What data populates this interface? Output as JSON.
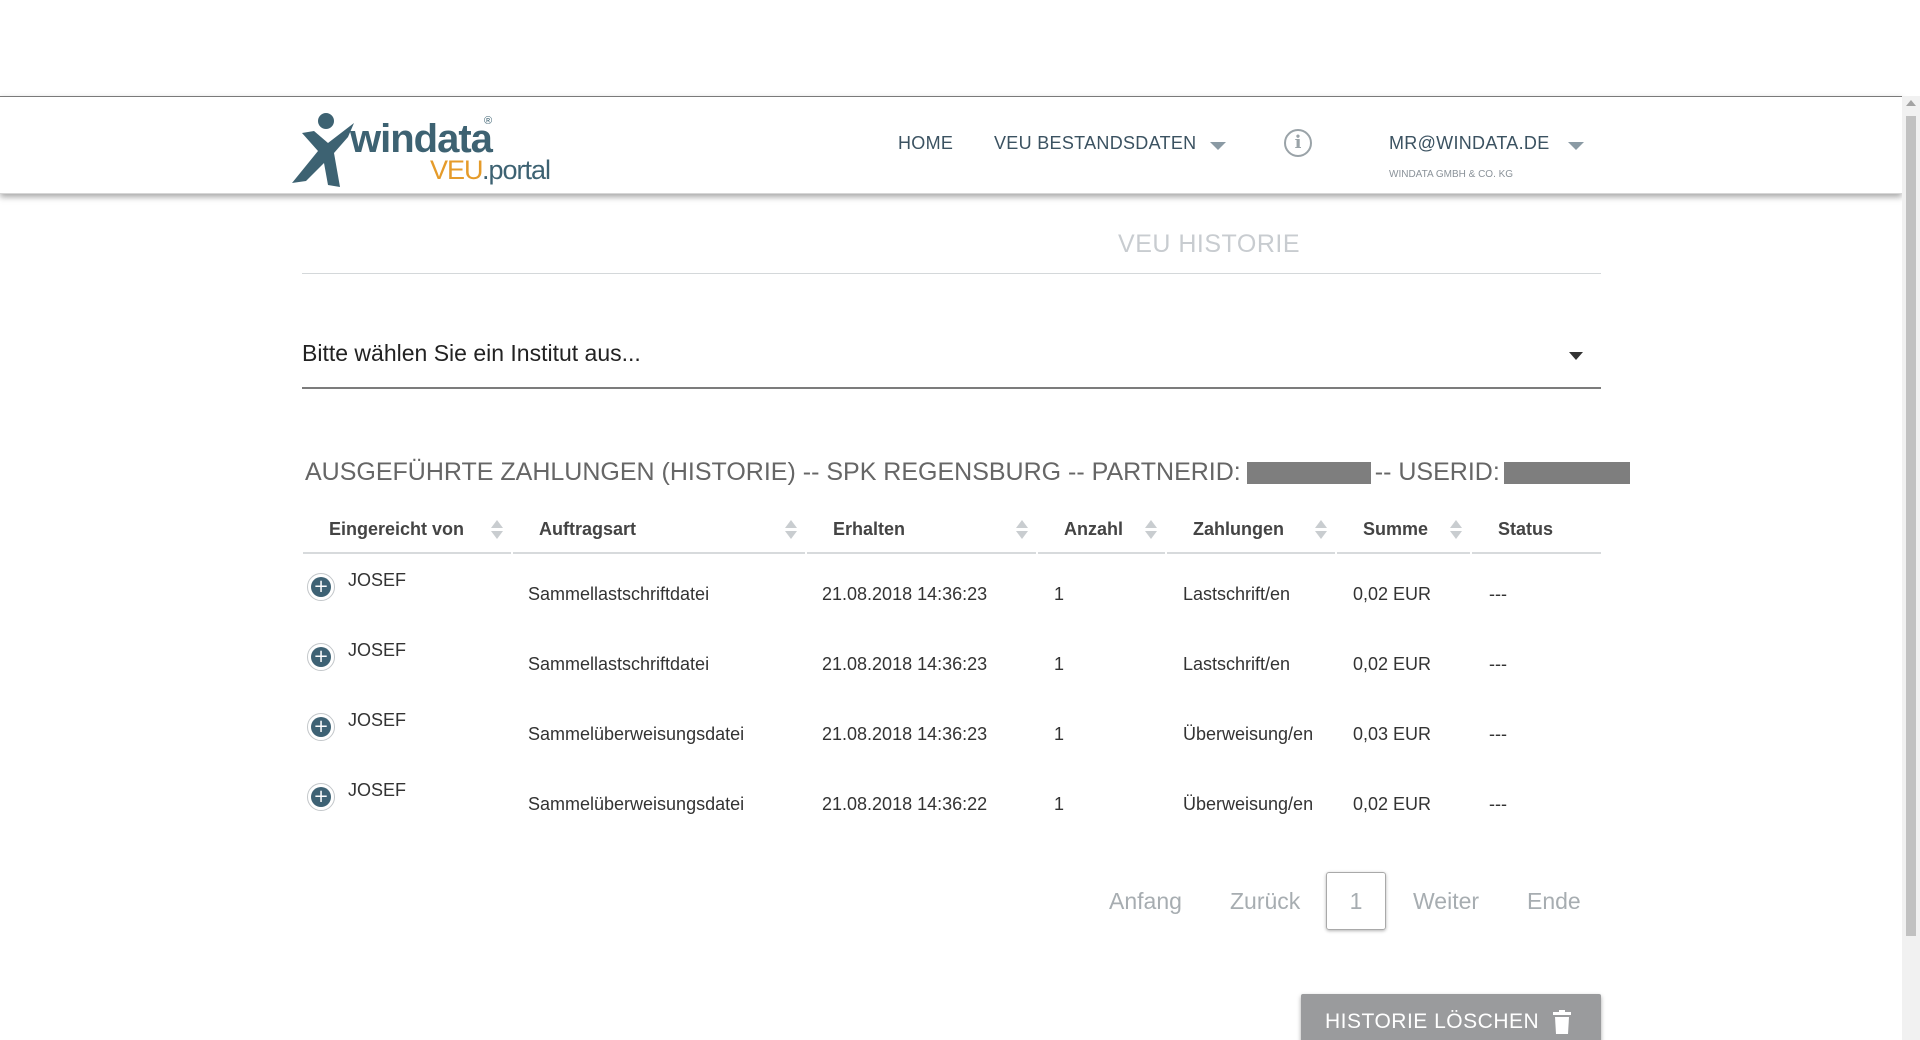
{
  "brand": {
    "word": "windata",
    "registered": "®",
    "product_veu": "VEU",
    "product_portal": ".portal"
  },
  "nav": {
    "home": "HOME",
    "bestandsdaten": "VEU BESTANDSDATEN",
    "info_glyph": "i",
    "user_email": "MR@WINDATA.DE",
    "user_company": "WINDATA GMBH & CO. KG"
  },
  "page": {
    "title": "VEU HISTORIE"
  },
  "institute_select": {
    "placeholder": "Bitte wählen Sie ein Institut aus..."
  },
  "section": {
    "heading_part1": "AUSGEFÜHRTE ZAHLUNGEN (HISTORIE) -- SPK REGENSBURG -- PARTNERID:",
    "heading_part2": "-- USERID:"
  },
  "table": {
    "columns": [
      "Eingereicht von",
      "Auftragsart",
      "Erhalten",
      "Anzahl",
      "Zahlungen",
      "Summe",
      "Status"
    ],
    "rows": [
      {
        "user": "JOSEF",
        "type": "Sammellastschriftdatei",
        "received": "21.08.2018 14:36:23",
        "count": "1",
        "payments": "Lastschrift/en",
        "sum": "0,02 EUR",
        "status": "---"
      },
      {
        "user": "JOSEF",
        "type": "Sammellastschriftdatei",
        "received": "21.08.2018 14:36:23",
        "count": "1",
        "payments": "Lastschrift/en",
        "sum": "0,02 EUR",
        "status": "---"
      },
      {
        "user": "JOSEF",
        "type": "Sammelüberweisungsdatei",
        "received": "21.08.2018 14:36:23",
        "count": "1",
        "payments": "Überweisung/en",
        "sum": "0,03 EUR",
        "status": "---"
      },
      {
        "user": "JOSEF",
        "type": "Sammelüberweisungsdatei",
        "received": "21.08.2018 14:36:22",
        "count": "1",
        "payments": "Überweisung/en",
        "sum": "0,02 EUR",
        "status": "---"
      }
    ],
    "expand_glyph": "+"
  },
  "pagination": {
    "first": "Anfang",
    "prev": "Zurück",
    "current": "1",
    "next": "Weiter",
    "last": "Ende"
  },
  "actions": {
    "delete_history": "HISTORIE LÖSCHEN"
  },
  "colors": {
    "brand_blue": "#3d6272",
    "brand_orange": "#e59b2a",
    "nav_text": "#3b5261",
    "button_gray": "#9a9b9d"
  }
}
